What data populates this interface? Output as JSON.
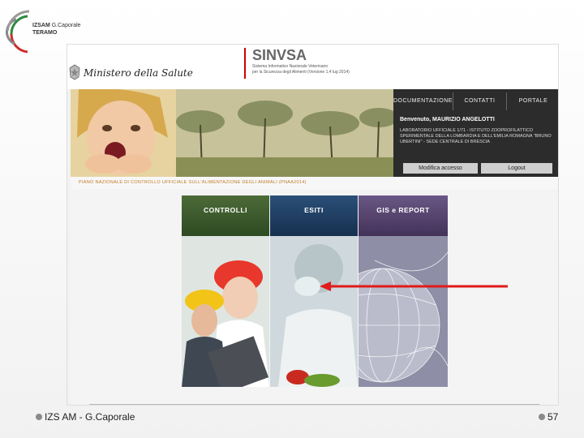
{
  "logo": {
    "brand": "IZSAM",
    "brand_suffix": "G.Caporale",
    "city": "TERAMO"
  },
  "footer": {
    "left": "IZS AM  -  G.Caporale",
    "page": "57"
  },
  "site": {
    "ministry": "Ministero della Salute",
    "title": "SINVSA",
    "subtitle_line1": "Sistema Informativo Nazionale Veterinario",
    "subtitle_line2": "per la Sicurezza degli Alimenti (Versione 1.4 lug 2014)"
  },
  "menu": {
    "tabs": [
      "DOCUMENTAZIONE",
      "CONTATTI",
      "PORTALE"
    ],
    "welcome": "Benvenuto, MAURIZIO ANGELOTTI",
    "lab_text": "LABORATORIO UFFICIALE 1/71 - ISTITUTO ZOOPROFILATTICO SPERIMENTALE DELLA LOMBARDIA E DELL'EMILIA ROMAGNA \"BRUNO UBERTINI\" - SEDE CENTRALE DI BRESCIA",
    "modify_button": "Modifica accesso",
    "logout_button": "Logout"
  },
  "piano": "PIANO NAZIONALE DI CONTROLLO UFFICIALE SULL'ALIMENTAZIONE DEGLI ANIMALI (PNAA2014)",
  "sections": [
    {
      "label": "CONTROLLI",
      "color": "#3a5a2c"
    },
    {
      "label": "ESITI",
      "color": "#1e3a5c"
    },
    {
      "label": "GIS e REPORT",
      "color": "#5a4872"
    }
  ],
  "colors": {
    "arrow": "#e21a1a",
    "menu_panel": "#2c2c2c",
    "accent_red": "#c00000"
  }
}
